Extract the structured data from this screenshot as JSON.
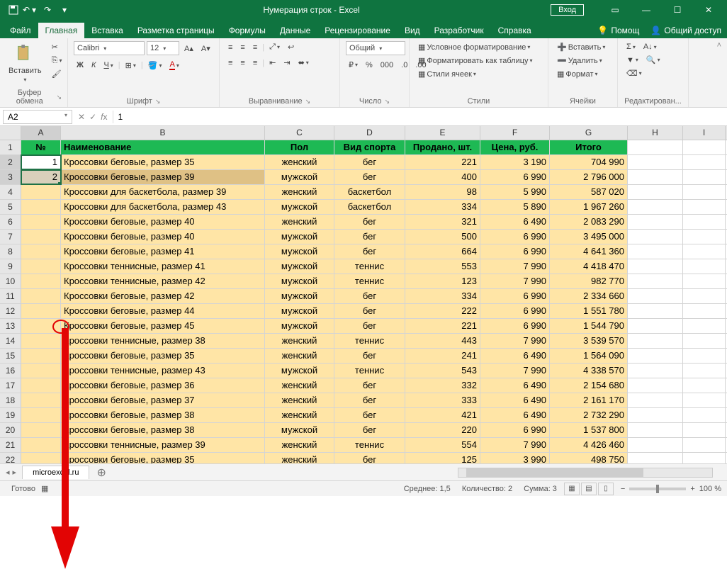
{
  "title": "Нумерация строк - Excel",
  "login_label": "Вход",
  "tabs": {
    "file": "Файл",
    "home": "Главная",
    "insert": "Вставка",
    "layout": "Разметка страницы",
    "formulas": "Формулы",
    "data": "Данные",
    "review": "Рецензирование",
    "view": "Вид",
    "developer": "Разработчик",
    "help": "Справка",
    "tellme": "Помощ",
    "share": "Общий доступ"
  },
  "ribbon": {
    "clipboard": {
      "paste": "Вставить",
      "label": "Буфер обмена"
    },
    "font": {
      "name": "Calibri",
      "size": "12",
      "label": "Шрифт",
      "bold": "Ж",
      "italic": "К",
      "underline": "Ч"
    },
    "align": {
      "label": "Выравнивание"
    },
    "number": {
      "format": "Общий",
      "label": "Число"
    },
    "styles": {
      "cond": "Условное форматирование",
      "table": "Форматировать как таблицу",
      "cell": "Стили ячеек",
      "label": "Стили"
    },
    "cells": {
      "insert": "Вставить",
      "delete": "Удалить",
      "format": "Формат",
      "label": "Ячейки"
    },
    "editing": {
      "label": "Редактирован..."
    }
  },
  "namebox": "A2",
  "formula": "1",
  "columns": [
    "A",
    "B",
    "C",
    "D",
    "E",
    "F",
    "G",
    "H",
    "I"
  ],
  "header": {
    "A": "№",
    "B": "Наименование",
    "C": "Пол",
    "D": "Вид спорта",
    "E": "Продано, шт.",
    "F": "Цена, руб.",
    "G": "Итого"
  },
  "rows": [
    {
      "n": "1",
      "b": "Кроссовки беговые, размер 35",
      "c": "женский",
      "d": "бег",
      "e": "221",
      "f": "3 190",
      "g": "704 990"
    },
    {
      "n": "2",
      "b": "Кроссовки беговые, размер 39",
      "c": "мужской",
      "d": "бег",
      "e": "400",
      "f": "6 990",
      "g": "2 796 000"
    },
    {
      "n": "",
      "b": "Кроссовки для баскетбола, размер 39",
      "c": "женский",
      "d": "баскетбол",
      "e": "98",
      "f": "5 990",
      "g": "587 020"
    },
    {
      "n": "",
      "b": "Кроссовки для баскетбола, размер 43",
      "c": "мужской",
      "d": "баскетбол",
      "e": "334",
      "f": "5 890",
      "g": "1 967 260"
    },
    {
      "n": "",
      "b": "Кроссовки беговые, размер 40",
      "c": "женский",
      "d": "бег",
      "e": "321",
      "f": "6 490",
      "g": "2 083 290"
    },
    {
      "n": "",
      "b": "Кроссовки беговые, размер 40",
      "c": "мужской",
      "d": "бег",
      "e": "500",
      "f": "6 990",
      "g": "3 495 000"
    },
    {
      "n": "",
      "b": "Кроссовки беговые, размер 41",
      "c": "мужской",
      "d": "бег",
      "e": "664",
      "f": "6 990",
      "g": "4 641 360"
    },
    {
      "n": "",
      "b": "Кроссовки теннисные, размер 41",
      "c": "мужской",
      "d": "теннис",
      "e": "553",
      "f": "7 990",
      "g": "4 418 470"
    },
    {
      "n": "",
      "b": "Кроссовки теннисные, размер 42",
      "c": "мужской",
      "d": "теннис",
      "e": "123",
      "f": "7 990",
      "g": "982 770"
    },
    {
      "n": "",
      "b": "Кроссовки беговые, размер 42",
      "c": "мужской",
      "d": "бег",
      "e": "334",
      "f": "6 990",
      "g": "2 334 660"
    },
    {
      "n": "",
      "b": "Кроссовки беговые, размер 44",
      "c": "мужской",
      "d": "бег",
      "e": "222",
      "f": "6 990",
      "g": "1 551 780"
    },
    {
      "n": "",
      "b": "Кроссовки беговые, размер 45",
      "c": "мужской",
      "d": "бег",
      "e": "221",
      "f": "6 990",
      "g": "1 544 790"
    },
    {
      "n": "",
      "b": "Кроссовки теннисные, размер 38",
      "c": "женский",
      "d": "теннис",
      "e": "443",
      "f": "7 990",
      "g": "3 539 570"
    },
    {
      "n": "",
      "b": "Кроссовки беговые, размер 35",
      "c": "женский",
      "d": "бег",
      "e": "241",
      "f": "6 490",
      "g": "1 564 090"
    },
    {
      "n": "",
      "b": "Кроссовки теннисные, размер 43",
      "c": "мужской",
      "d": "теннис",
      "e": "543",
      "f": "7 990",
      "g": "4 338 570"
    },
    {
      "n": "",
      "b": "Кроссовки беговые, размер 36",
      "c": "женский",
      "d": "бег",
      "e": "332",
      "f": "6 490",
      "g": "2 154 680"
    },
    {
      "n": "",
      "b": "Кроссовки беговые, размер 37",
      "c": "женский",
      "d": "бег",
      "e": "333",
      "f": "6 490",
      "g": "2 161 170"
    },
    {
      "n": "",
      "b": "Кроссовки беговые, размер 38",
      "c": "женский",
      "d": "бег",
      "e": "421",
      "f": "6 490",
      "g": "2 732 290"
    },
    {
      "n": "",
      "b": "Кроссовки беговые, размер 38",
      "c": "мужской",
      "d": "бег",
      "e": "220",
      "f": "6 990",
      "g": "1 537 800"
    },
    {
      "n": "",
      "b": "Кроссовки теннисные, размер 39",
      "c": "женский",
      "d": "теннис",
      "e": "554",
      "f": "7 990",
      "g": "4 426 460"
    },
    {
      "n": "",
      "b": "Кроссовки беговые, размер 35",
      "c": "женский",
      "d": "бег",
      "e": "125",
      "f": "3 990",
      "g": "498 750"
    }
  ],
  "sheet_name": "microexcel.ru",
  "status": {
    "ready": "Готово",
    "avg": "Среднее: 1,5",
    "count": "Количество: 2",
    "sum": "Сумма: 3",
    "zoom": "100 %"
  }
}
